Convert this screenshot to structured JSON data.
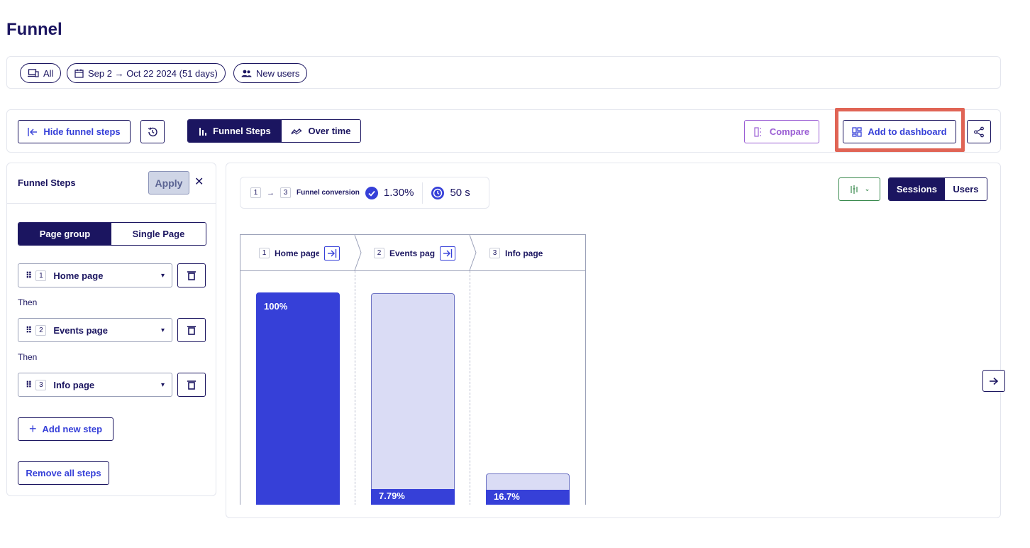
{
  "page": {
    "title": "Funnel"
  },
  "filters": {
    "device": "All",
    "date_range": "Sep 2 → Oct 22 2024 (51 days)",
    "audience": "New users"
  },
  "toolbar": {
    "hide_steps_label": "Hide funnel steps",
    "view_tabs": [
      {
        "label": "Funnel Steps",
        "active": true
      },
      {
        "label": "Over time",
        "active": false
      }
    ],
    "compare_label": "Compare",
    "add_dashboard_label": "Add to dashboard"
  },
  "steps_panel": {
    "title": "Funnel Steps",
    "apply_label": "Apply",
    "mode_tabs": [
      {
        "label": "Page group",
        "active": true
      },
      {
        "label": "Single Page",
        "active": false
      }
    ],
    "steps": [
      {
        "num": "1",
        "name": "Home page"
      },
      {
        "num": "2",
        "name": "Events page"
      },
      {
        "num": "3",
        "name": "Info page"
      }
    ],
    "then_label": "Then",
    "add_step_label": "Add new step",
    "remove_all_label": "Remove all steps"
  },
  "conversion": {
    "from": "1",
    "to": "3",
    "label": "Funnel conversion",
    "rate": "1.30%",
    "time": "50 s"
  },
  "metric_tabs": [
    {
      "label": "Sessions",
      "active": true
    },
    {
      "label": "Users",
      "active": false
    }
  ],
  "chart_data": {
    "type": "bar",
    "categories": [
      "Home page",
      "Events page",
      "Info page"
    ],
    "category_labels": [
      "Home page",
      "Events pag",
      "Info page"
    ],
    "step_numbers": [
      "1",
      "2",
      "3"
    ],
    "conversion_labels": [
      "100%",
      "7.79%",
      "16.7%"
    ],
    "values": [
      100,
      7.79,
      1.3
    ],
    "dropoff_shown": [
      0,
      92.21,
      6.49
    ],
    "ylim": [
      0,
      100
    ],
    "colors": {
      "converted": "#3640d8",
      "dropoff": "#dadcf5",
      "dropoff_border": "#6e74c4"
    }
  }
}
